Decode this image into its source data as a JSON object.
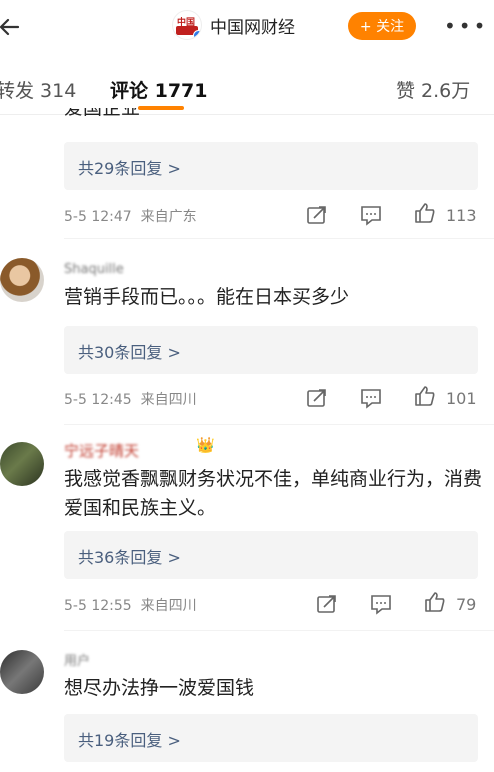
{
  "header": {
    "title": "中国网财经",
    "follow_label": "+ 关注",
    "more_label": "•••",
    "logo_text": "中国"
  },
  "tabs": {
    "repost": "转发 314",
    "comment": "评论 1771",
    "like": "赞 2.6万"
  },
  "comments": [
    {
      "text": "爱国企业",
      "replies": "共29条回复 >",
      "time": "5-5 12:47",
      "source": "来自广东",
      "likes": "113"
    },
    {
      "username": "Shaquille",
      "text": "营销手段而已。。。能在日本买多少",
      "replies": "共30条回复 >",
      "time": "5-5 12:45",
      "source": "来自四川",
      "likes": "101"
    },
    {
      "username": "宁远子晴天",
      "text": "我感觉香飘飘财务状况不佳，单纯商业行为，消费爱国和民族主义。",
      "replies": "共36条回复 >",
      "time": "5-5 12:55",
      "source": "来自四川",
      "likes": "79"
    },
    {
      "username": "用户",
      "text": "想尽办法挣一波爱国钱",
      "replies": "共19条回复 >"
    }
  ],
  "colors": {
    "accent": "#ff8200",
    "link": "#4a5f7e",
    "reply_bg": "#f4f4f4"
  }
}
